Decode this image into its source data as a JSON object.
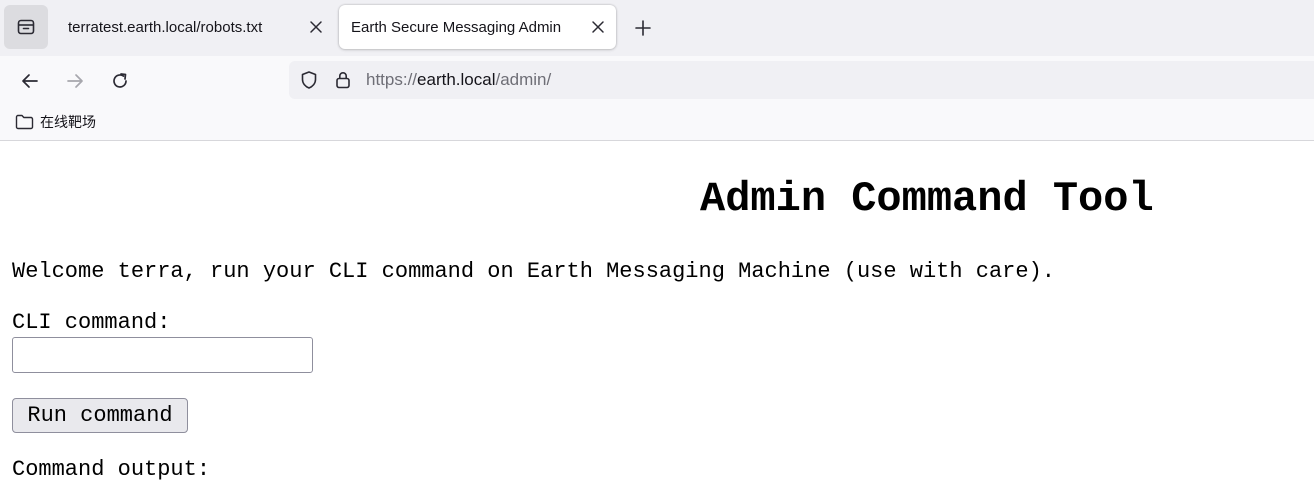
{
  "browser": {
    "tabs": [
      {
        "title": "terratest.earth.local/robots.txt",
        "active": false
      },
      {
        "title": "Earth Secure Messaging Admin",
        "active": true
      }
    ],
    "url": {
      "scheme": "https://",
      "host": "earth.local",
      "path": "/admin/"
    },
    "bookmarks": [
      {
        "label": "在线靶场",
        "icon": "folder-icon"
      }
    ],
    "icons": {
      "tab_list": "tab-list-icon",
      "close": "close-icon",
      "new_tab": "plus-icon",
      "back": "arrow-left-icon",
      "forward": "arrow-right-icon",
      "reload": "reload-icon",
      "tracking_protection": "shield-icon",
      "security": "lock-icon"
    }
  },
  "page": {
    "title": "Admin Command Tool",
    "welcome": "Welcome terra, run your CLI command on Earth Messaging Machine (use with care).",
    "cli_label": "CLI command:",
    "cli_value": "",
    "run_button": "Run command",
    "output_label": "Command output:"
  }
}
